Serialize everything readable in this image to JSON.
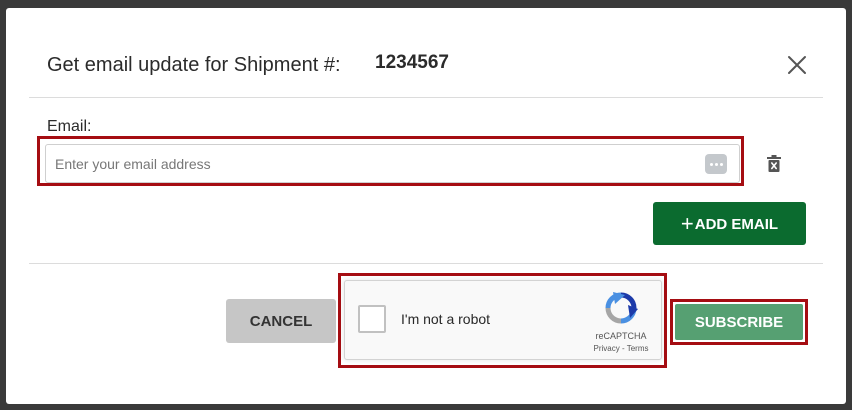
{
  "dialog": {
    "title_label": "Get email update for Shipment #:",
    "shipment_number": "1234567"
  },
  "email": {
    "label": "Email:",
    "value": "",
    "placeholder": "Enter your email address",
    "add_button_label": "ADD EMAIL",
    "add_button_icon": "+"
  },
  "actions": {
    "cancel_label": "CANCEL",
    "subscribe_label": "SUBSCRIBE"
  },
  "captcha": {
    "checkbox_label": "I'm not a robot",
    "brand": "reCAPTCHA",
    "privacy_label": "Privacy",
    "separator": " - ",
    "terms_label": "Terms"
  },
  "icons": {
    "close": "close-icon",
    "password_manager": "password-manager-icon",
    "trash": "trash-icon",
    "recaptcha": "recaptcha-logo-icon"
  },
  "colors": {
    "overlay": "#3a3a3a",
    "primary_green": "#0b6b2f",
    "subscribe_green": "#56a072",
    "cancel_gray": "#c6c6c6",
    "highlight_red": "#a50d12"
  }
}
